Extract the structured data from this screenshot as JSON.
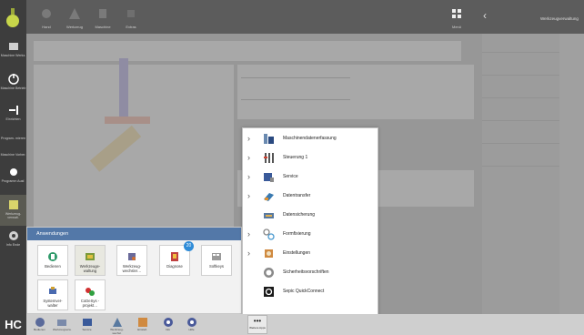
{
  "app": {
    "logo_letters": "HC"
  },
  "left_nav": [
    {
      "key": "home",
      "label": ""
    },
    {
      "key": "macro",
      "label": "Maschine Werkz."
    },
    {
      "key": "power",
      "label": "Maschine Betrieb"
    },
    {
      "key": "step",
      "label": "Einrichten"
    },
    {
      "key": "process",
      "label": "Program-\nmieren"
    },
    {
      "key": "edit",
      "label": "Maschine Vorber."
    },
    {
      "key": "record",
      "label": "Programm Ausf."
    },
    {
      "key": "grid",
      "label": "Werkzeug-\nverwalt."
    },
    {
      "key": "settings",
      "label": "Info Ende"
    }
  ],
  "top_bar": {
    "items": [
      "Hand",
      "Werkzeug",
      "Maschine",
      "Extras"
    ],
    "right_label": "Menü",
    "title": "Werkzeugverwaltung"
  },
  "apps_panel": {
    "title": "Anwendungen",
    "tiles": [
      {
        "label": "Bedienen",
        "icon": "bedienen-icon",
        "badge": ""
      },
      {
        "label": "Werkzeuge-\nwaltung",
        "icon": "werkzeug-icon",
        "badge": "",
        "selected": true
      },
      {
        "label": "Werkzeug-\nwechsler…",
        "icon": "wechsler-icon",
        "badge": ""
      },
      {
        "label": "Diagnose",
        "icon": "diagnose-icon",
        "badge": "20"
      },
      {
        "label": "Softkeys",
        "icon": "softkeys-icon",
        "badge": ""
      },
      {
        "label": "Systemver-\nwalter",
        "icon": "system-icon",
        "badge": ""
      },
      {
        "label": "CoDeSys -\nprojekt…",
        "icon": "codesys-icon",
        "badge": ""
      }
    ]
  },
  "menu": {
    "items": [
      {
        "label": "Maschinendatenerfassung",
        "icon": "mde-icon",
        "has_sub": true
      },
      {
        "label": "Steuerung 1",
        "icon": "steuerung-icon",
        "has_sub": true
      },
      {
        "label": "Service",
        "icon": "service-icon",
        "has_sub": true
      },
      {
        "label": "Datentransfer",
        "icon": "transfer-icon",
        "has_sub": true
      },
      {
        "label": "Datensicherung",
        "icon": "backup-icon",
        "has_sub": false
      },
      {
        "label": "Formfixierung",
        "icon": "form-icon",
        "has_sub": true
      },
      {
        "label": "Einstellungen",
        "icon": "settings-icon",
        "has_sub": true
      },
      {
        "label": "Sicherheitsvorschriften",
        "icon": "safety-icon",
        "has_sub": false
      },
      {
        "label": "Sepic QuickConnect",
        "icon": "quickconnect-icon",
        "has_sub": false
      }
    ]
  },
  "bottom_bar": {
    "items": [
      "Bedienen",
      "Werkzeugverw.",
      "Service",
      "Werkzeug-wechsl.",
      "Einstell.",
      "Info",
      "Hilfe"
    ],
    "more_label": "Weitere Apps"
  },
  "colors": {
    "header_blue": "#5378a8",
    "badge_blue": "#2f8cd8",
    "nav_dark": "#3d3d3d"
  }
}
